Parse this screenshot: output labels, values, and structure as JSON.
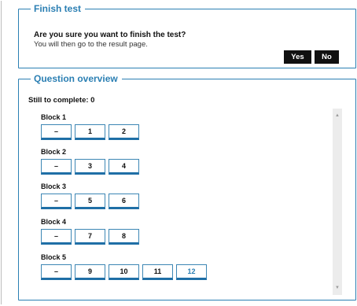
{
  "finish": {
    "title": "Finish test",
    "question": "Are you sure you want to finish the test?",
    "subtext": "You will then go to the result page.",
    "yes_label": "Yes",
    "no_label": "No"
  },
  "overview": {
    "title": "Question overview",
    "still_to_complete": "Still to complete: 0",
    "blocks": [
      {
        "label": "Block 1",
        "items": [
          "–",
          "1",
          "2"
        ]
      },
      {
        "label": "Block 2",
        "items": [
          "–",
          "3",
          "4"
        ]
      },
      {
        "label": "Block 3",
        "items": [
          "–",
          "5",
          "6"
        ]
      },
      {
        "label": "Block 4",
        "items": [
          "–",
          "7",
          "8"
        ]
      },
      {
        "label": "Block 5",
        "items": [
          "–",
          "9",
          "10",
          "11",
          "12"
        ]
      }
    ],
    "active_item": "12"
  },
  "colors": {
    "accent": "#2b7fb3",
    "button_dark": "#111111"
  },
  "icons": {
    "scroll_up": "scroll-up-arrow-icon",
    "scroll_down": "scroll-down-arrow-icon"
  }
}
